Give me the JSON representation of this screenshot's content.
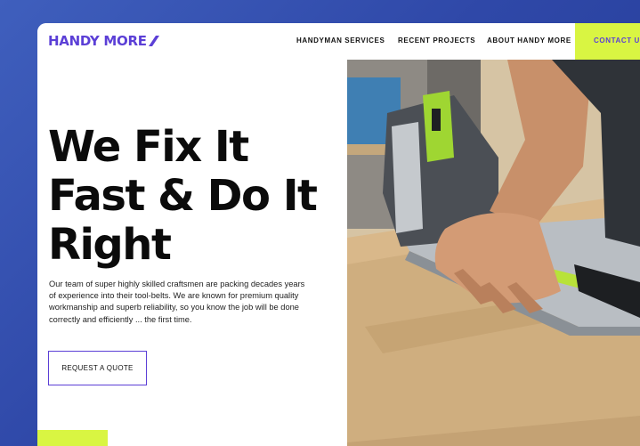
{
  "brand": {
    "name": "HANDY MORE",
    "accent": "#5b3fd6",
    "highlight": "#d9f542"
  },
  "nav": {
    "links": [
      "HANDYMAN SERVICES",
      "RECENT PROJECTS",
      "ABOUT HANDY MORE"
    ],
    "cta": "CONTACT US"
  },
  "hero": {
    "title_lines": [
      "We Fix It",
      "Fast & Do It",
      "Right"
    ],
    "body": "Our team of super highly skilled craftsmen are packing decades years of experience into their tool-belts. We are known for premium quality workmanship and superb reliability, so you know the job will be done correctly and efficiently ... the first time.",
    "button": "REQUEST A QUOTE"
  },
  "image": {
    "subject": "craftsman-cutting-wood-with-plunge-saw"
  }
}
